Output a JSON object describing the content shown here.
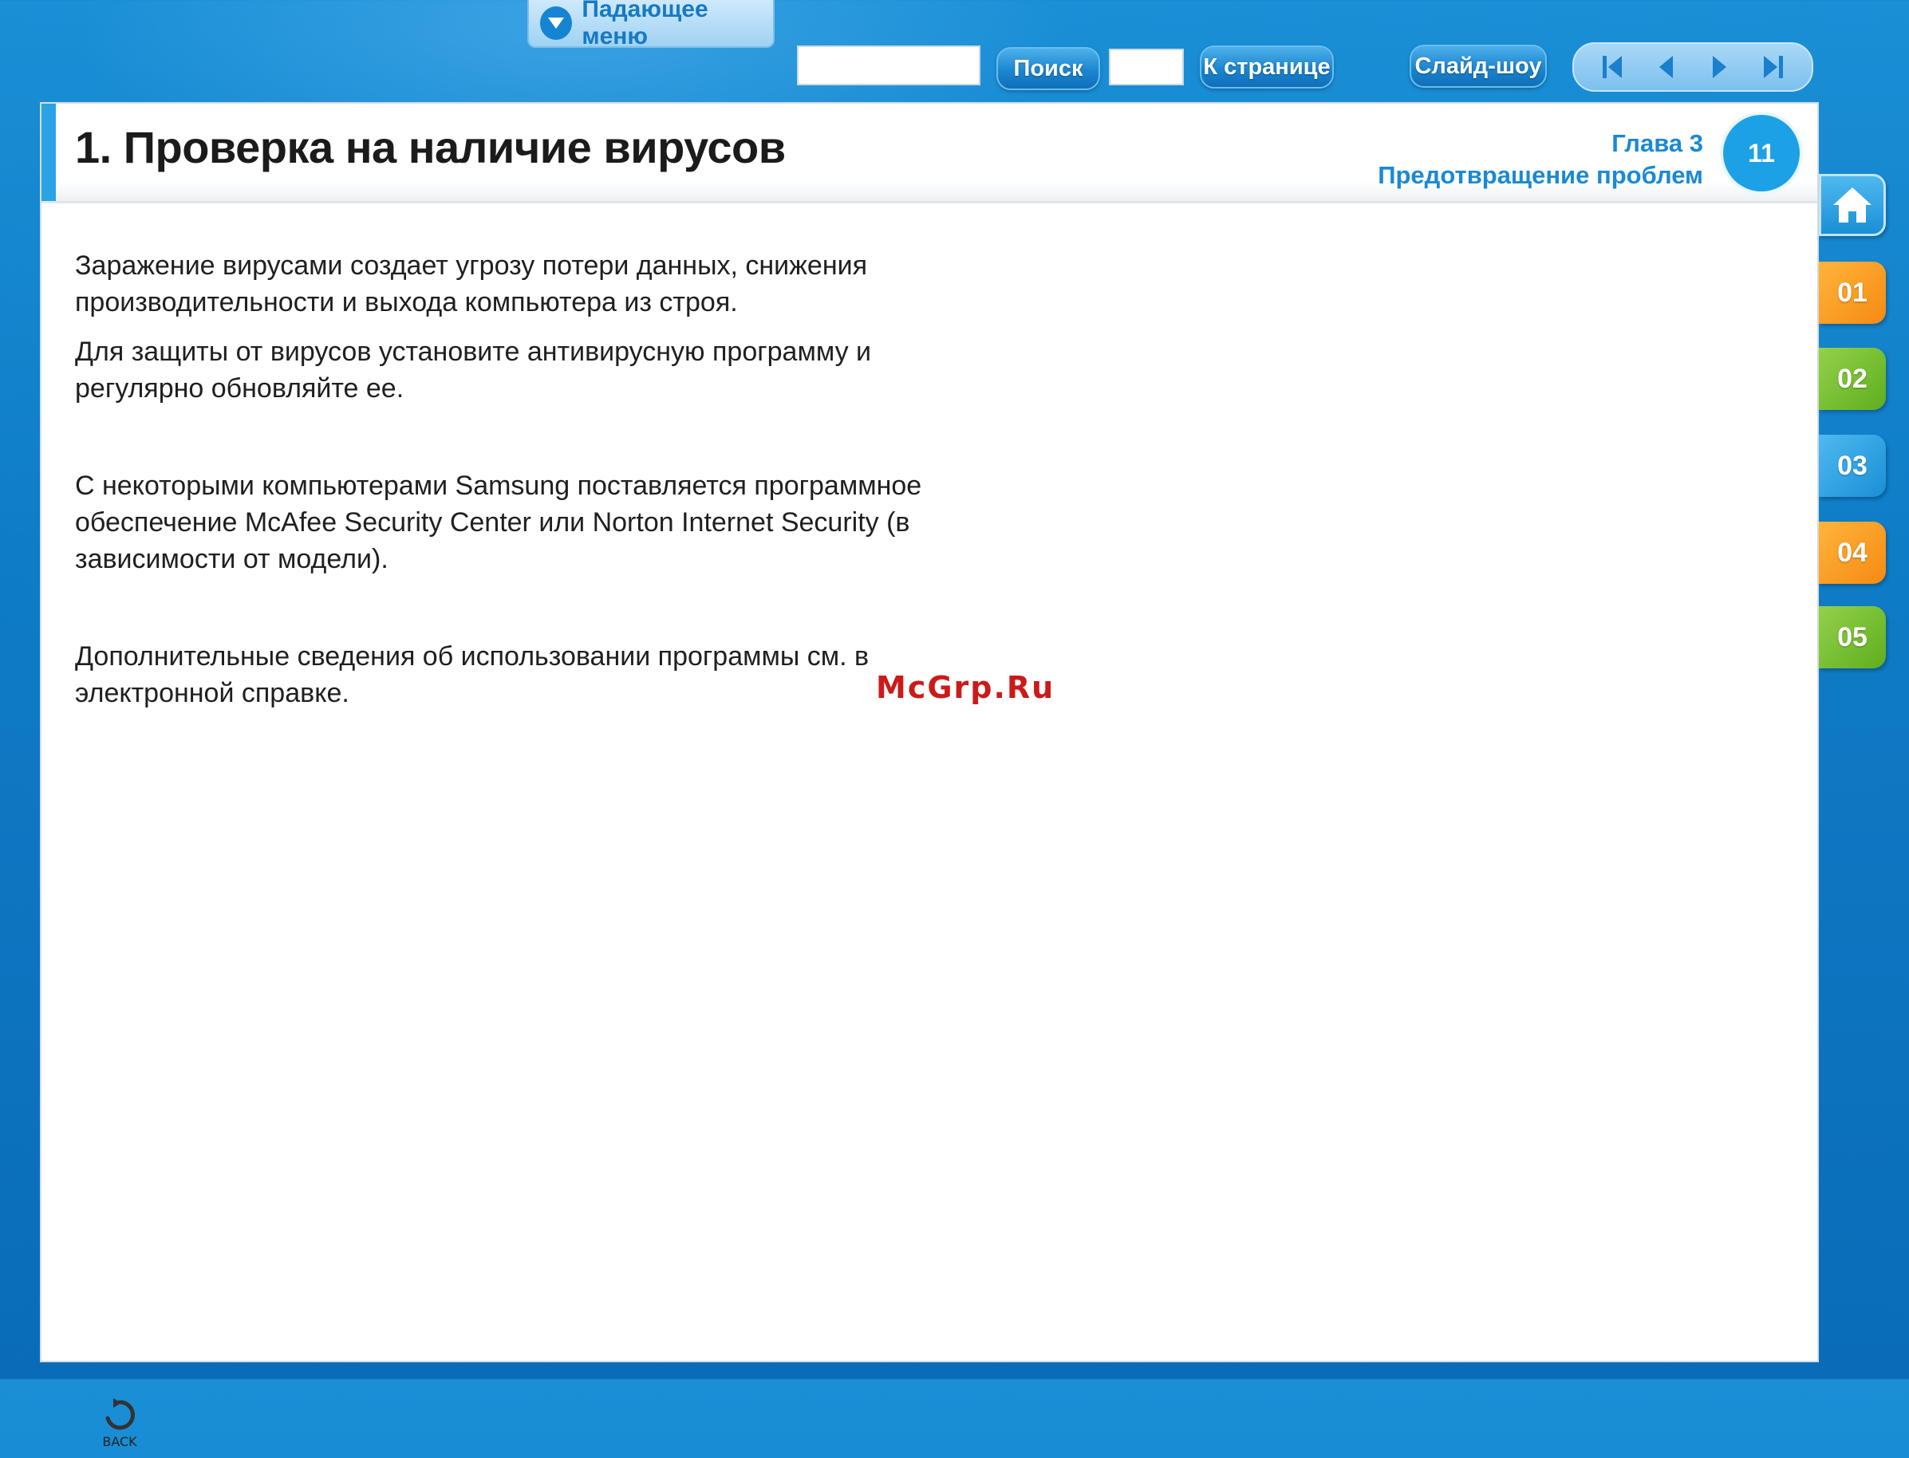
{
  "toolbar": {
    "dropdown_label": "Падающее меню",
    "search_value": "",
    "search_button": "Поиск",
    "page_value": "",
    "goto_page_button": "К странице",
    "slideshow_button": "Слайд-шоу",
    "nav_icons": [
      "first-page-icon",
      "previous-page-icon",
      "next-page-icon",
      "last-page-icon"
    ]
  },
  "header": {
    "title": "1. Проверка на наличие вирусов",
    "chapter": "Глава 3",
    "chapter_name": "Предотвращение проблем",
    "page_number": "11"
  },
  "body": {
    "paragraphs": [
      "Заражение вирусами создает угрозу потери данных, снижения производительности и выхода компьютера из строя.",
      "Для защиты от вирусов установите антивирусную программу и регулярно обновляйте ее.",
      "С некоторыми компьютерами Samsung поставляется программное обеспечение McAfee Security Center или Norton Internet Security (в зависимости от модели).",
      "Дополнительные сведения об использовании программы см. в электронной справке."
    ]
  },
  "watermark": "McGrp.Ru",
  "back": {
    "label": "BACK"
  },
  "side_tabs": {
    "home_icon": "home-icon",
    "chapters": [
      "01",
      "02",
      "03",
      "04",
      "05"
    ]
  },
  "colors": {
    "accent_blue": "#1a89d4",
    "background_blue": "#0f7cc7",
    "tab_orange": "#f58a12",
    "tab_green": "#5fae1e"
  }
}
